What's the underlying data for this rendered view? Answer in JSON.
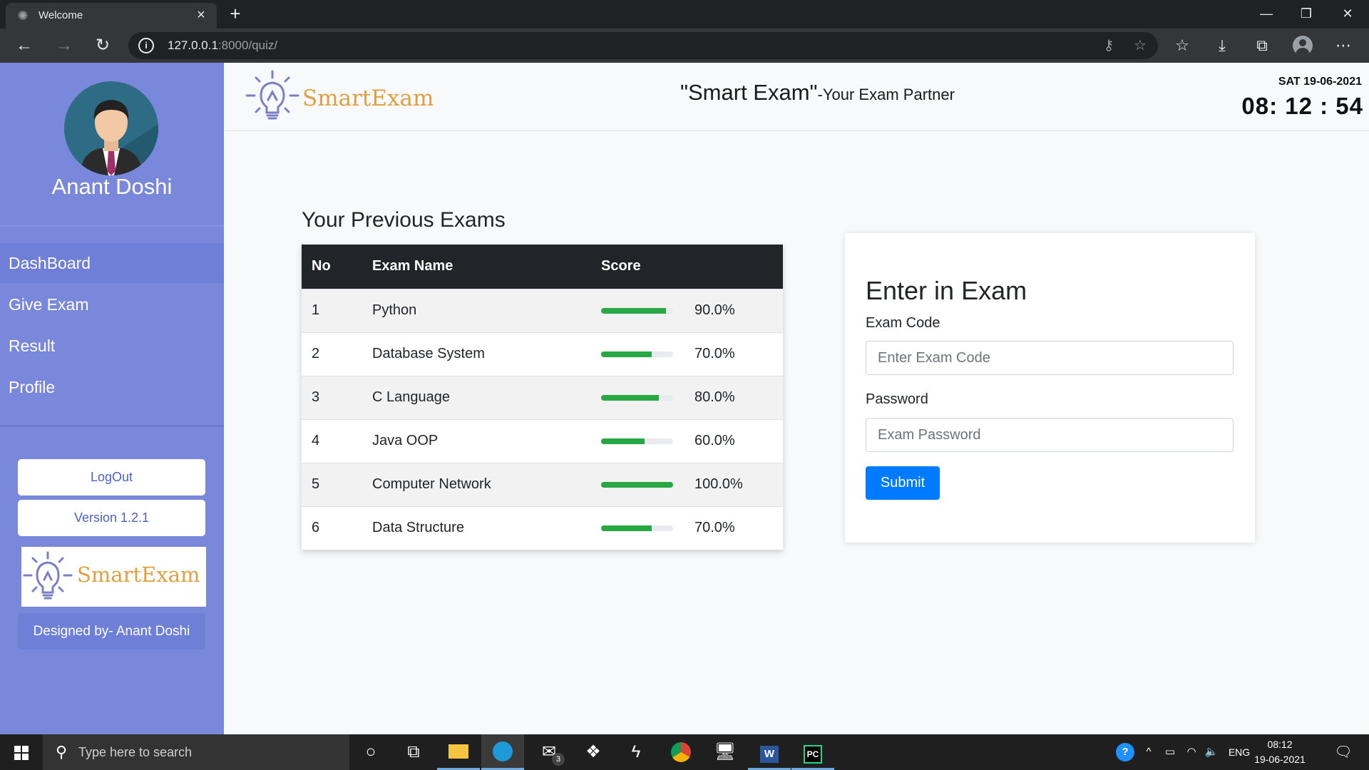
{
  "browser": {
    "tab_title": "Welcome",
    "url_host": "127.0.0.1",
    "url_rest": ":8000/quiz/"
  },
  "sidebar": {
    "user_name": "Anant Doshi",
    "menu": [
      {
        "label": "DashBoard",
        "active": true
      },
      {
        "label": "Give Exam",
        "active": false
      },
      {
        "label": "Result",
        "active": false
      },
      {
        "label": "Profile",
        "active": false
      }
    ],
    "logout_label": "LogOut",
    "version_label": "Version 1.2.1",
    "logo_text": "SmartExam",
    "designed_by": "Designed by- Anant Doshi"
  },
  "header": {
    "logo_text": "SmartExam",
    "title_main": "\"Smart Exam\"",
    "title_sub": "-Your Exam Partner",
    "date": "SAT 19-06-2021",
    "time": "08: 12 : 54"
  },
  "previous_exams": {
    "title": "Your Previous Exams",
    "columns": [
      "No",
      "Exam Name",
      "Score"
    ],
    "rows": [
      {
        "no": "1",
        "name": "Python",
        "score": "90.0%",
        "percent": 90
      },
      {
        "no": "2",
        "name": "Database System",
        "score": "70.0%",
        "percent": 70
      },
      {
        "no": "3",
        "name": "C Language",
        "score": "80.0%",
        "percent": 80
      },
      {
        "no": "4",
        "name": "Java OOP",
        "score": "60.0%",
        "percent": 60
      },
      {
        "no": "5",
        "name": "Computer Network",
        "score": "100.0%",
        "percent": 100
      },
      {
        "no": "6",
        "name": "Data Structure",
        "score": "70.0%",
        "percent": 70
      }
    ]
  },
  "exam_form": {
    "title": "Enter in Exam",
    "code_label": "Exam Code",
    "code_placeholder": "Enter Exam Code",
    "password_label": "Password",
    "password_placeholder": "Exam Password",
    "submit_label": "Submit"
  },
  "taskbar": {
    "search_placeholder": "Type here to search",
    "mail_badge": "3",
    "language": "ENG",
    "time": "08:12",
    "date": "19-06-2021"
  },
  "colors": {
    "sidebar": "#7a88db",
    "table_header": "#212529",
    "progress": "#28a745",
    "submit": "#007bff",
    "logo_text": "#e0a040"
  }
}
